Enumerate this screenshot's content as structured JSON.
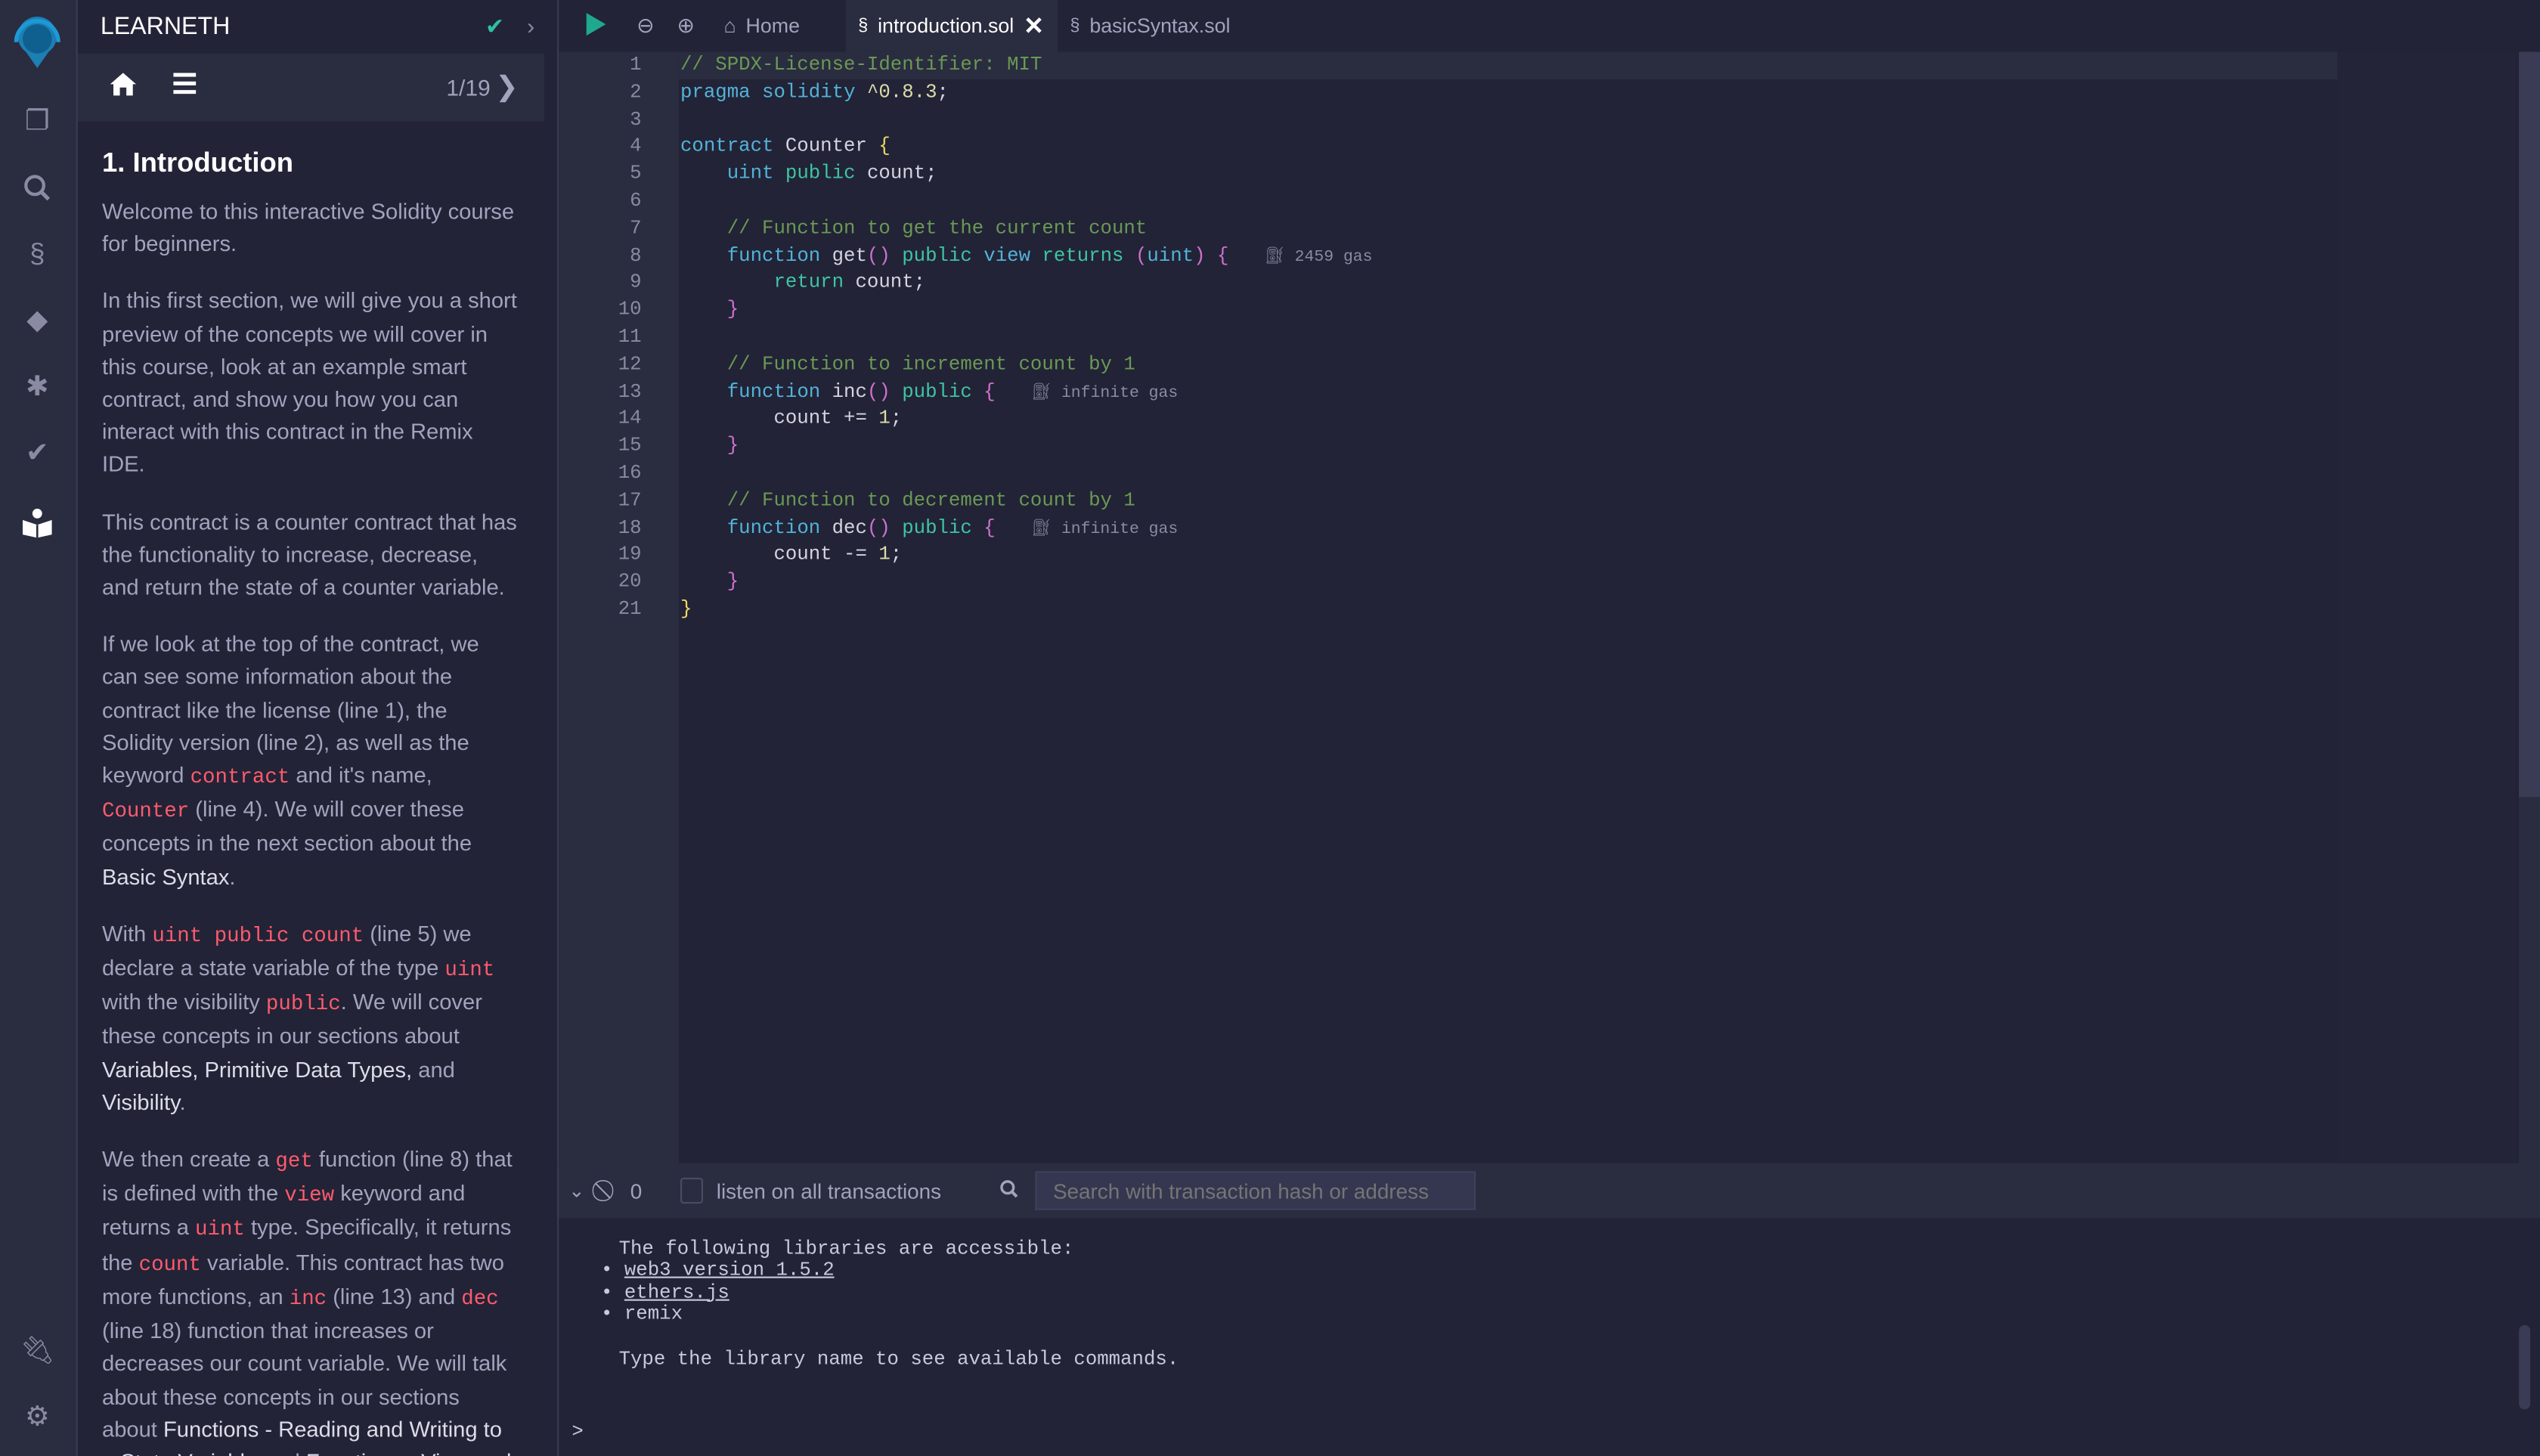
{
  "icon_bar": {
    "items": [
      "remix-logo-icon",
      "file-explorer-icon",
      "search-icon",
      "solidity-compiler-icon",
      "deploy-run-icon",
      "debugger-icon",
      "solidity-unit-testing-icon",
      "learneth-icon",
      "plugin-manager-icon",
      "settings-icon"
    ]
  },
  "panel": {
    "title": "LEARNETH",
    "progress": "1/19",
    "heading": "1. Introduction",
    "paragraphs": [
      [
        {
          "t": "Welcome to this interactive Solidity course for beginners."
        }
      ],
      [
        {
          "t": "In this first section, we will give you a short preview of the concepts we will cover in this course, look at an example smart contract, and show you how you can interact with this contract in the Remix IDE."
        }
      ],
      [
        {
          "t": "This contract is a counter contract that has the functionality to increase, decrease, and return the state of a counter variable."
        }
      ],
      [
        {
          "t": "If we look at the top of the contract, we can see some information about the contract like the license (line 1), the Solidity version (line 2), as well as the keyword "
        },
        {
          "t": "contract",
          "c": "code"
        },
        {
          "t": " and it's name, "
        },
        {
          "t": "Counter",
          "c": "code"
        },
        {
          "t": " (line 4). We will cover these concepts in the next section about the "
        },
        {
          "t": "Basic Syntax",
          "c": "b"
        },
        {
          "t": "."
        }
      ],
      [
        {
          "t": "With "
        },
        {
          "t": "uint public count",
          "c": "code"
        },
        {
          "t": " (line 5) we declare a state variable of the type "
        },
        {
          "t": "uint",
          "c": "code"
        },
        {
          "t": " with the visibility "
        },
        {
          "t": "public",
          "c": "code"
        },
        {
          "t": ". We will cover these concepts in our sections about "
        },
        {
          "t": "Variables, Primitive Data Types,",
          "c": "b"
        },
        {
          "t": " and "
        },
        {
          "t": "Visibility",
          "c": "b"
        },
        {
          "t": "."
        }
      ],
      [
        {
          "t": "We then create a "
        },
        {
          "t": "get",
          "c": "code"
        },
        {
          "t": " function (line 8) that is defined with the "
        },
        {
          "t": "view",
          "c": "code"
        },
        {
          "t": " keyword and returns a "
        },
        {
          "t": "uint",
          "c": "code"
        },
        {
          "t": " type. Specifically, it returns the "
        },
        {
          "t": "count",
          "c": "code"
        },
        {
          "t": " variable. This contract has two more functions, an "
        },
        {
          "t": "inc",
          "c": "code"
        },
        {
          "t": " (line 13) and "
        },
        {
          "t": "dec",
          "c": "code"
        },
        {
          "t": " (line 18) function that increases or decreases our count variable. We will talk about these concepts in our sections about "
        },
        {
          "t": "Functions - Reading and Writing to a State Variable",
          "c": "b"
        },
        {
          "t": " and "
        },
        {
          "t": "Functions - View and pure",
          "c": "b"
        },
        {
          "t": "."
        }
      ]
    ]
  },
  "tabs": [
    {
      "label": "Home"
    },
    {
      "label": "introduction.sol"
    },
    {
      "label": "basicSyntax.sol"
    }
  ],
  "editor": {
    "lines": [
      [
        {
          "t": "// SPDX-License-Identifier: MIT",
          "c": "cm"
        }
      ],
      [
        {
          "t": "pragma",
          "c": "k"
        },
        {
          "t": " "
        },
        {
          "t": "solidity",
          "c": "k"
        },
        {
          "t": " ^0.8.3",
          "c": "n"
        },
        {
          "t": ";",
          "c": "id"
        }
      ],
      [],
      [
        {
          "t": "contract",
          "c": "k"
        },
        {
          "t": " Counter ",
          "c": "id"
        },
        {
          "t": "{",
          "c": "br"
        }
      ],
      [
        {
          "t": "    "
        },
        {
          "t": "uint",
          "c": "k"
        },
        {
          "t": " "
        },
        {
          "t": "public",
          "c": "k2"
        },
        {
          "t": " count;",
          "c": "id"
        }
      ],
      [],
      [
        {
          "t": "    // Function to get the current count",
          "c": "cm"
        }
      ],
      [
        {
          "t": "    "
        },
        {
          "t": "function",
          "c": "k"
        },
        {
          "t": " get",
          "c": "id"
        },
        {
          "t": "()",
          "c": "pp"
        },
        {
          "t": " "
        },
        {
          "t": "public",
          "c": "k2"
        },
        {
          "t": " "
        },
        {
          "t": "view",
          "c": "k"
        },
        {
          "t": " "
        },
        {
          "t": "returns",
          "c": "k2"
        },
        {
          "t": " "
        },
        {
          "t": "(",
          "c": "pp"
        },
        {
          "t": "uint",
          "c": "k"
        },
        {
          "t": ")",
          "c": "pp"
        },
        {
          "t": " "
        },
        {
          "t": "{",
          "c": "pp"
        },
        {
          "t": "2459 gas",
          "c": "gas"
        }
      ],
      [
        {
          "t": "        "
        },
        {
          "t": "return",
          "c": "k2"
        },
        {
          "t": " count;",
          "c": "id"
        }
      ],
      [
        {
          "t": "    "
        },
        {
          "t": "}",
          "c": "pp"
        }
      ],
      [],
      [
        {
          "t": "    // Function to increment count by 1",
          "c": "cm"
        }
      ],
      [
        {
          "t": "    "
        },
        {
          "t": "function",
          "c": "k"
        },
        {
          "t": " inc",
          "c": "id"
        },
        {
          "t": "()",
          "c": "pp"
        },
        {
          "t": " "
        },
        {
          "t": "public",
          "c": "k2"
        },
        {
          "t": " "
        },
        {
          "t": "{",
          "c": "pp"
        },
        {
          "t": "infinite gas",
          "c": "gas"
        }
      ],
      [
        {
          "t": "        count += ",
          "c": "id"
        },
        {
          "t": "1",
          "c": "n"
        },
        {
          "t": ";",
          "c": "id"
        }
      ],
      [
        {
          "t": "    "
        },
        {
          "t": "}",
          "c": "pp"
        }
      ],
      [],
      [
        {
          "t": "    // Function to decrement count by 1",
          "c": "cm"
        }
      ],
      [
        {
          "t": "    "
        },
        {
          "t": "function",
          "c": "k"
        },
        {
          "t": " dec",
          "c": "id"
        },
        {
          "t": "()",
          "c": "pp"
        },
        {
          "t": " "
        },
        {
          "t": "public",
          "c": "k2"
        },
        {
          "t": " "
        },
        {
          "t": "{",
          "c": "pp"
        },
        {
          "t": "infinite gas",
          "c": "gas"
        }
      ],
      [
        {
          "t": "        count -= ",
          "c": "id"
        },
        {
          "t": "1",
          "c": "n"
        },
        {
          "t": ";",
          "c": "id"
        }
      ],
      [
        {
          "t": "    "
        },
        {
          "t": "}",
          "c": "pp"
        }
      ],
      [
        {
          "t": "}",
          "c": "br"
        }
      ]
    ]
  },
  "terminal": {
    "pending_count": "0",
    "listen_label": "listen on all transactions",
    "search_placeholder": "Search with transaction hash or address",
    "intro": "The following libraries are accessible:",
    "libs": [
      "web3 version 1.5.2",
      "ethers.js",
      "remix"
    ],
    "hint": "Type the library name to see available commands.",
    "prompt": ">"
  },
  "colors": {
    "accent": "#2fbfa0",
    "code_red": "#ff5a6e",
    "bg": "#222336"
  }
}
